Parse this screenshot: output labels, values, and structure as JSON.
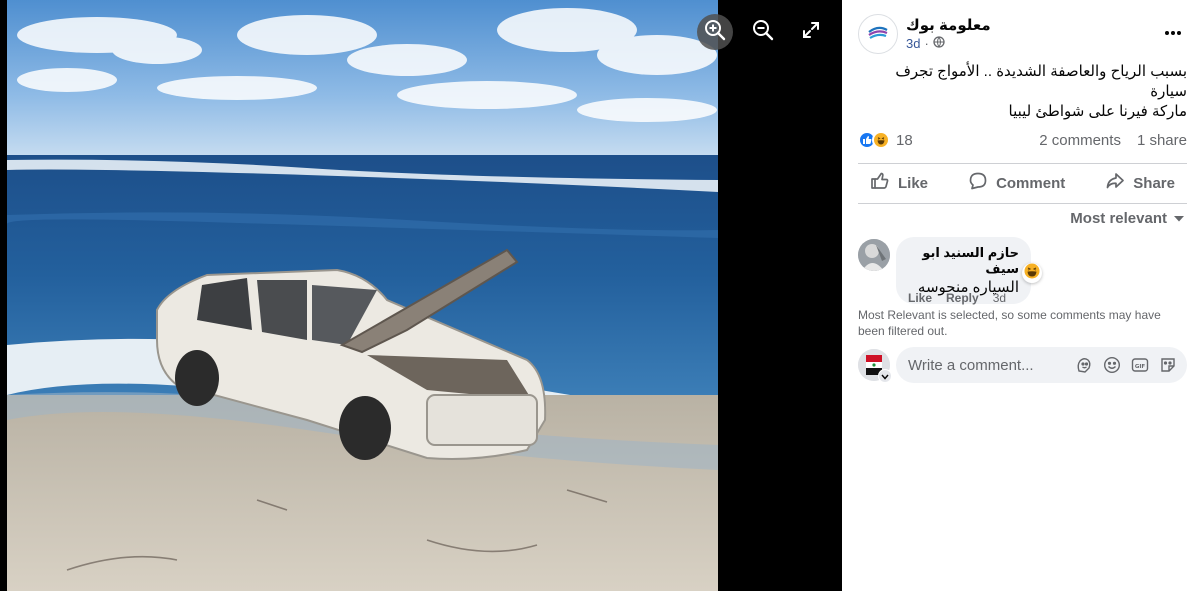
{
  "viewer": {
    "tools": {
      "zoom_in": "zoom-in-icon",
      "zoom_out": "zoom-out-icon",
      "fullscreen": "fullscreen-icon"
    }
  },
  "post": {
    "page_name": "معلومة بوك",
    "time": "3d",
    "separator": "·",
    "privacy_icon": "globe-icon",
    "text_line1": "بسبب الرياح والعاصفة الشديدة .. الأمواج تجرف سيارة",
    "text_line2": "ماركة فيرنا على شواطئ ليبيا",
    "reaction_count": "18",
    "comments_count": "2 comments",
    "shares_count": "1 share"
  },
  "actions": {
    "like": "Like",
    "comment": "Comment",
    "share": "Share"
  },
  "comments": {
    "sort_label": "Most relevant",
    "items": [
      {
        "author": "حازم السنيد ابو سيف",
        "text": "السياره منحوسه",
        "like": "Like",
        "reply": "Reply",
        "time": "3d"
      }
    ],
    "filter_note": "Most Relevant is selected, so some comments may have been filtered out.",
    "composer_placeholder": "Write a comment..."
  },
  "colors": {
    "like_blue": "#1877f2",
    "haha_yellow": "#f7b125",
    "link_blue": "#385898",
    "muted": "#65676b"
  }
}
